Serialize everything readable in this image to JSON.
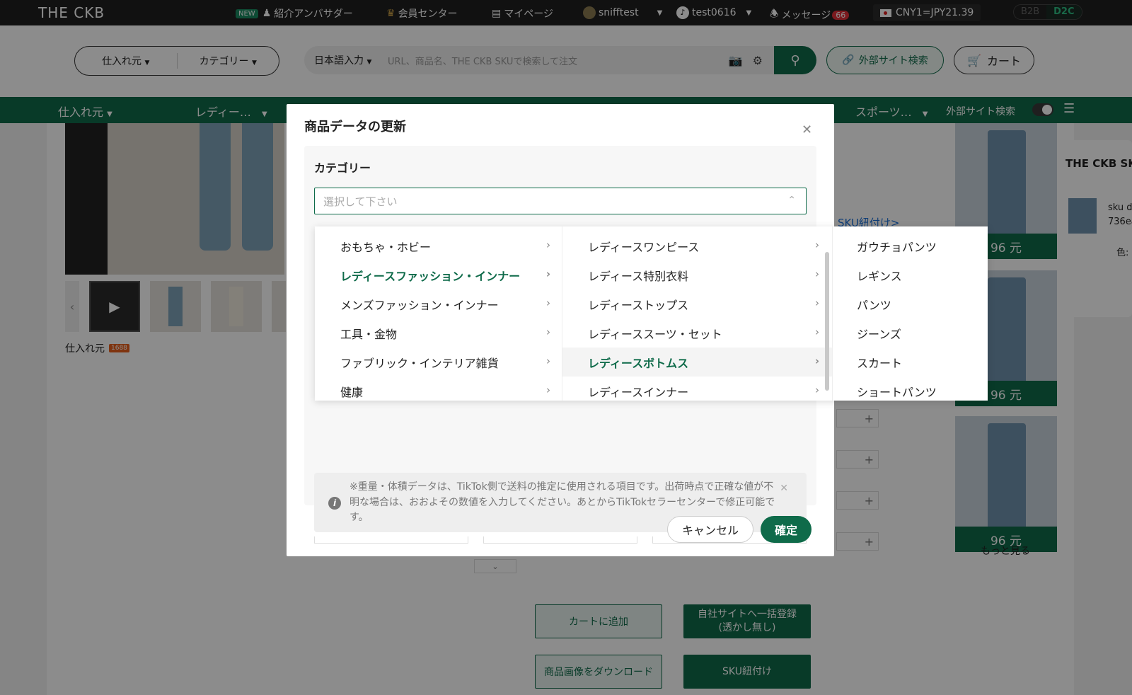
{
  "topbar": {
    "logo": "THE CKB",
    "new_badge": "NEW",
    "ambassador": "紹介アンバサダー",
    "member_center": "会員センター",
    "mypage": "マイページ",
    "store_name": "snifftest",
    "tiktok_account": "test0616",
    "messages": "メッセージ",
    "message_count": "66",
    "currency": "CNY1=JPY21.39",
    "b2b": "B2B",
    "d2c": "D2C"
  },
  "search": {
    "source_select": "仕入れ元",
    "category_select": "カテゴリー",
    "language": "日本語入力",
    "placeholder": "URL、商品名、THE CKB SKUで検索して注文",
    "external_search": "外部サイト検索",
    "cart": "カート"
  },
  "nav": {
    "source": "仕入れ元",
    "ladies": "レディー…",
    "sports": "スポーツ…",
    "external_search": "外部サイト検索"
  },
  "background": {
    "source_label": "仕入れ元",
    "source_tag": "1688",
    "sku_link": "SKU紐付け>",
    "prices": [
      "96 元",
      "96 元",
      "96 元"
    ],
    "more": "もっと見る",
    "side_title": "THE CKB SKU",
    "sku_line1": "sku d",
    "sku_line2": "736ea",
    "sku_line3": "色:",
    "add_to_cart": "カートに追加",
    "bulk_register": "自社サイトへ一括登録\n(透かし無し)",
    "download_images": "商品画像をダウンロード",
    "sku_bind": "SKU紐付け"
  },
  "modal": {
    "title": "商品データの更新",
    "category_label": "カテゴリー",
    "select_placeholder": "選択して下さい",
    "note": "※重量・体積データは、TikTok側で送料の推定に使用される項目です。出荷時点で正確な値が不明な場合は、おおよその数値を入力してください。あとからTikTokセラーセンターで修正可能です。",
    "cancel": "キャンセル",
    "confirm": "確定"
  },
  "cascader": {
    "level1": [
      {
        "label": "おもちゃ・ホビー",
        "active": false
      },
      {
        "label": "レディースファッション・インナー",
        "active": true
      },
      {
        "label": "メンズファッション・インナー",
        "active": false
      },
      {
        "label": "工具・金物",
        "active": false
      },
      {
        "label": "ファブリック・インテリア雑貨",
        "active": false
      },
      {
        "label": "健康",
        "active": false
      }
    ],
    "level2": [
      {
        "label": "レディースワンピース",
        "active": false
      },
      {
        "label": "レディース特別衣料",
        "active": false
      },
      {
        "label": "レディーストップス",
        "active": false
      },
      {
        "label": "レディーススーツ・セット",
        "active": false
      },
      {
        "label": "レディースボトムス",
        "active": true
      },
      {
        "label": "レディースインナー",
        "active": false
      }
    ],
    "level3": [
      {
        "label": "ガウチョパンツ"
      },
      {
        "label": "レギンス"
      },
      {
        "label": "パンツ"
      },
      {
        "label": "ジーンズ"
      },
      {
        "label": "スカート"
      },
      {
        "label": "ショートパンツ"
      }
    ]
  },
  "colors": {
    "brand_green": "#0f6b4a",
    "topbar": "#1f1f1f",
    "link_blue": "#1a6fd8"
  }
}
